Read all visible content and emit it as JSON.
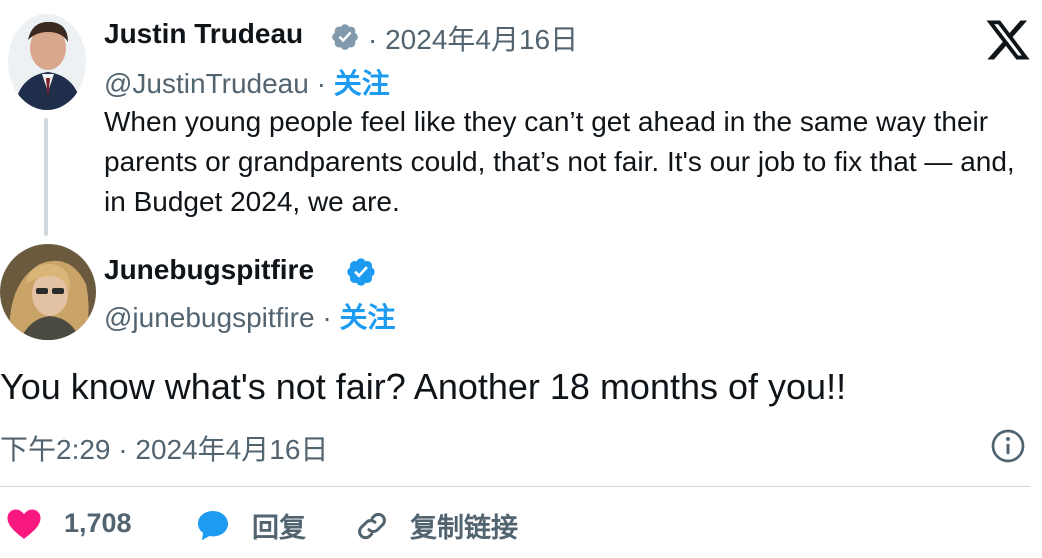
{
  "parent_tweet": {
    "author_name": "Justin Trudeau",
    "date": "· 2024年4月16日",
    "handle": "@JustinTrudeau",
    "follow_label": "关注",
    "text": "When young people feel like they can’t get ahead in the same way their parents or grandparents could, that’s not fair. It's our job to fix that — and, in Budget 2024, we are."
  },
  "reply_tweet": {
    "author_name": "Junebugspitfire",
    "handle": "@junebugspitfire",
    "follow_label": "关注",
    "text": "You know what's not fair? Another 18 months of you!!",
    "timestamp": "下午2:29 · 2024年4月16日"
  },
  "actions": {
    "like_count": "1,708",
    "reply_label": "回复",
    "copy_link_label": "复制链接"
  },
  "colors": {
    "link_blue": "#1d9bf0",
    "verified_blue": "#1d9bf0",
    "verified_gray": "#829aab",
    "like_pink": "#f91880",
    "muted_text": "#536471"
  },
  "icons": {
    "brand": "x-logo-icon",
    "verified_parent": "gray-verified-badge-icon",
    "verified_reply": "blue-verified-badge-icon",
    "info": "info-icon",
    "like": "heart-icon",
    "reply": "speech-bubble-icon",
    "copy": "link-icon"
  }
}
